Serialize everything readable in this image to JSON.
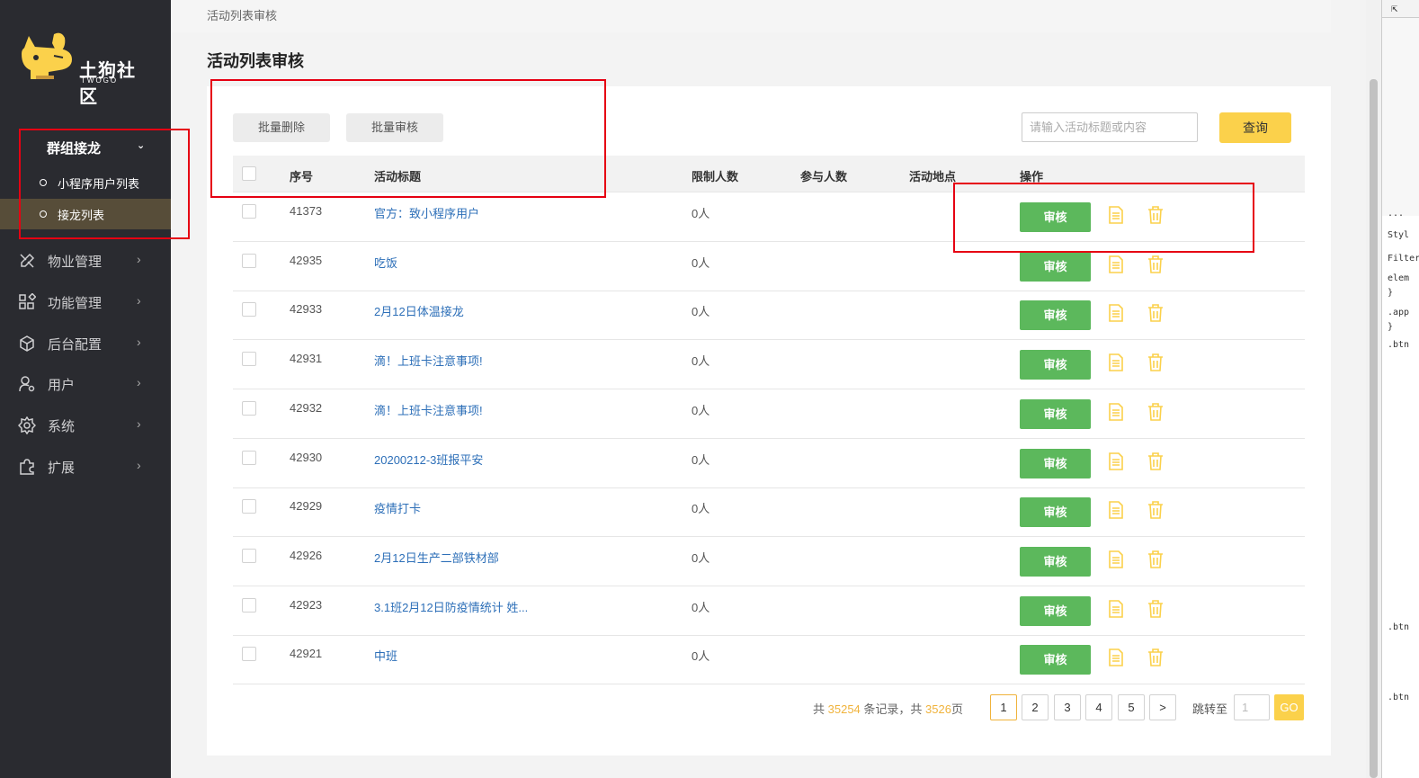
{
  "sidebar": {
    "logo": {
      "text": "土狗社区",
      "subtext": "TWOGO",
      "brand_color": "#fbd14b"
    },
    "group": {
      "label": "群组接龙",
      "items": [
        {
          "label": "小程序用户列表"
        },
        {
          "label": "接龙列表"
        }
      ]
    },
    "items": [
      {
        "label": "物业管理",
        "icon": "tools-icon"
      },
      {
        "label": "功能管理",
        "icon": "grid-icon"
      },
      {
        "label": "后台配置",
        "icon": "cube-icon"
      },
      {
        "label": "用户",
        "icon": "user-gear-icon"
      },
      {
        "label": "系统",
        "icon": "gear-icon"
      },
      {
        "label": "扩展",
        "icon": "puzzle-icon"
      }
    ]
  },
  "breadcrumb": "活动列表审核",
  "page_title": "活动列表审核",
  "toolbar": {
    "batch_delete": "批量删除",
    "batch_audit": "批量审核",
    "search_placeholder": "请输入活动标题或内容",
    "query": "查询"
  },
  "table": {
    "columns": [
      "序号",
      "活动标题",
      "限制人数",
      "参与人数",
      "活动地点",
      "操作"
    ],
    "action_label": "审核",
    "rows": [
      {
        "id": "41373",
        "title": "官方：致小程序用户",
        "limit": "0人",
        "participants": "",
        "location": ""
      },
      {
        "id": "42935",
        "title": "吃饭",
        "limit": "0人",
        "participants": "",
        "location": ""
      },
      {
        "id": "42933",
        "title": "2月12日体温接龙",
        "limit": "0人",
        "participants": "",
        "location": ""
      },
      {
        "id": "42931",
        "title": "滴！上班卡注意事项!",
        "limit": "0人",
        "participants": "",
        "location": ""
      },
      {
        "id": "42932",
        "title": "滴！上班卡注意事项!",
        "limit": "0人",
        "participants": "",
        "location": ""
      },
      {
        "id": "42930",
        "title": "20200212-3班报平安",
        "limit": "0人",
        "participants": "",
        "location": ""
      },
      {
        "id": "42929",
        "title": "疫情打卡",
        "limit": "0人",
        "participants": "",
        "location": ""
      },
      {
        "id": "42926",
        "title": "2月12日生产二部铁材部",
        "limit": "0人",
        "participants": "",
        "location": ""
      },
      {
        "id": "42923",
        "title": "3.1班2月12日防疫情统计 姓...",
        "limit": "0人",
        "participants": "",
        "location": ""
      },
      {
        "id": "42921",
        "title": "中班",
        "limit": "0人",
        "participants": "",
        "location": ""
      }
    ]
  },
  "pagination": {
    "prefix": "共 ",
    "total_records": "35254",
    "middle": " 条记录，共 ",
    "total_pages": "3526",
    "suffix": "页",
    "pages": [
      "1",
      "2",
      "3",
      "4",
      "5"
    ],
    "next": ">",
    "jump_label": "跳转至",
    "jump_placeholder": "1",
    "go": "GO"
  },
  "devtools": {
    "lines": [
      "...",
      "Styl",
      "Filter",
      "elem",
      "}",
      ".app",
      "}",
      ".btn",
      ".btn",
      ".btn"
    ]
  },
  "colors": {
    "sidebar_bg": "#2a2b30",
    "accent_yellow": "#fbd14b",
    "audit_green": "#5cb85c",
    "link_blue": "#2d6fb8",
    "annotation_red": "#e60012"
  }
}
